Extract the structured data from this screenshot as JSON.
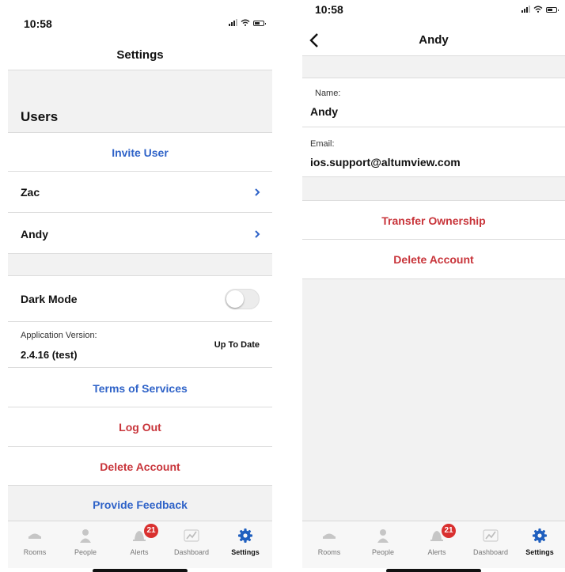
{
  "left_screen": {
    "status": {
      "time": "10:58"
    },
    "title": "Settings",
    "users_header": "Users",
    "invite_user": "Invite User",
    "users": [
      {
        "name": "Zac"
      },
      {
        "name": "Andy"
      }
    ],
    "dark_mode": {
      "label": "Dark Mode",
      "enabled": false
    },
    "app_version": {
      "label": "Application Version:",
      "value": "2.4.16 (test)",
      "status": "Up To Date"
    },
    "terms": "Terms of Services",
    "log_out": "Log Out",
    "delete_account": "Delete Account",
    "feedback": "Provide Feedback"
  },
  "right_screen": {
    "status": {
      "time": "10:58"
    },
    "title": "Andy",
    "name_label": "Name:",
    "name_value": "Andy",
    "email_label": "Email:",
    "email_value": "ios.support@altumview.com",
    "transfer_ownership": "Transfer Ownership",
    "delete_account": "Delete Account"
  },
  "tabbar": {
    "tabs": [
      {
        "label": "Rooms",
        "icon": "bed-icon"
      },
      {
        "label": "People",
        "icon": "person-icon"
      },
      {
        "label": "Alerts",
        "icon": "bell-icon",
        "badge": "21"
      },
      {
        "label": "Dashboard",
        "icon": "chart-icon"
      },
      {
        "label": "Settings",
        "icon": "gear-icon",
        "active": true
      }
    ]
  },
  "colors": {
    "link_blue": "#2f63c8",
    "danger_red": "#c8343a",
    "badge_red": "#d9302f",
    "settings_icon_blue": "#1f5fbf",
    "section_gray": "#f2f2f2"
  }
}
